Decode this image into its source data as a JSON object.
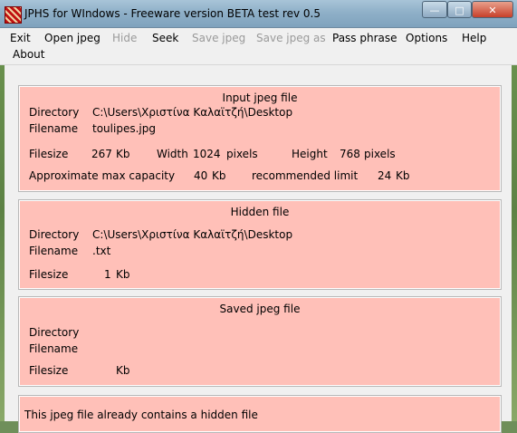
{
  "window": {
    "title": "JPHS for WIndows - Freeware version BETA test rev 0.5",
    "min_glyph": "—",
    "max_glyph": "□",
    "close_glyph": "✕"
  },
  "menu": {
    "items": [
      {
        "label": "Exit",
        "enabled": true
      },
      {
        "label": "Open jpeg",
        "enabled": true
      },
      {
        "label": "Hide",
        "enabled": false
      },
      {
        "label": "Seek",
        "enabled": true
      },
      {
        "label": "Save jpeg",
        "enabled": false
      },
      {
        "label": "Save jpeg as",
        "enabled": false
      },
      {
        "label": "Pass phrase",
        "enabled": true
      },
      {
        "label": "Options",
        "enabled": true
      },
      {
        "label": "Help",
        "enabled": true
      },
      {
        "label": "About",
        "enabled": true
      }
    ]
  },
  "input_jpeg": {
    "title": "Input jpeg file",
    "directory_label": "Directory",
    "directory_value": "C:\\Users\\Χριστίνα Καλαϊτζή\\Desktop",
    "filename_label": "Filename",
    "filename_value": "toulipes.jpg",
    "filesize_label": "Filesize",
    "filesize_value": "267",
    "filesize_unit": "Kb",
    "width_label": "Width",
    "width_value": "1024",
    "width_unit": "pixels",
    "height_label": "Height",
    "height_value": "768",
    "height_unit": "pixels",
    "capacity_label": "Approximate max capacity",
    "capacity_value": "40",
    "capacity_unit": "Kb",
    "limit_label": "recommended limit",
    "limit_value": "24",
    "limit_unit": "Kb"
  },
  "hidden_file": {
    "title": "Hidden file",
    "directory_label": "Directory",
    "directory_value": "C:\\Users\\Χριστίνα Καλαϊτζή\\Desktop",
    "filename_label": "Filename",
    "filename_value": ".txt",
    "filesize_label": "Filesize",
    "filesize_value": "1",
    "filesize_unit": "Kb"
  },
  "saved_jpeg": {
    "title": "Saved jpeg file",
    "directory_label": "Directory",
    "filename_label": "Filename",
    "filesize_label": "Filesize",
    "filesize_unit": "Kb"
  },
  "status": {
    "message": "This jpeg file already contains a hidden file"
  },
  "colors": {
    "panel_bg": "#ffc0b8",
    "client_bg": "#f0f0f0",
    "close_button": "#c7402a"
  }
}
